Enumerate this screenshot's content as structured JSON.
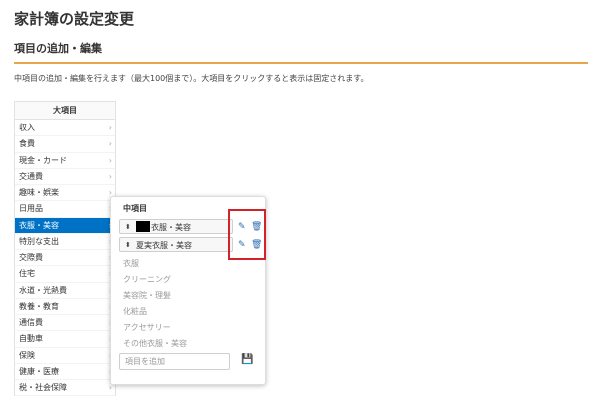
{
  "page": {
    "title": "家計簿の設定変更"
  },
  "section": {
    "title": "項目の追加・編集",
    "description": "中項目の追加・編集を行えます（最大100個まで）。大項目をクリックすると表示は固定されます。"
  },
  "categories": {
    "header": "大項目",
    "items": [
      {
        "label": "収入",
        "active": false
      },
      {
        "label": "食費",
        "active": false
      },
      {
        "label": "現金・カード",
        "active": false
      },
      {
        "label": "交通費",
        "active": false
      },
      {
        "label": "趣味・娯楽",
        "active": false
      },
      {
        "label": "日用品",
        "active": false
      },
      {
        "label": "衣服・美容",
        "active": true
      },
      {
        "label": "特別な支出",
        "active": false
      },
      {
        "label": "交際費",
        "active": false
      },
      {
        "label": "住宅",
        "active": false
      },
      {
        "label": "水道・光熱費",
        "active": false
      },
      {
        "label": "教養・教育",
        "active": false
      },
      {
        "label": "通信費",
        "active": false
      },
      {
        "label": "自動車",
        "active": false
      },
      {
        "label": "保険",
        "active": false
      },
      {
        "label": "健康・医療",
        "active": false
      },
      {
        "label": "税・社会保障",
        "active": false
      }
    ]
  },
  "subcategories": {
    "header": "中項目",
    "custom_items": [
      {
        "label": "衣服・美容",
        "redacted_prefix": true
      },
      {
        "label": "夏実衣服・美容",
        "redacted_prefix": false
      }
    ],
    "default_items": [
      "衣服",
      "クリーニング",
      "美容院・理髪",
      "化粧品",
      "アクセサリー",
      "その他衣服・美容"
    ],
    "add_input": {
      "placeholder": "項目を追加",
      "value": ""
    }
  },
  "icons": {
    "chevron": "chevron-right-icon",
    "drag": "drag-handle-icon",
    "edit": "pencil-icon",
    "delete": "trash-icon",
    "save": "save-icon"
  },
  "colors": {
    "accent_underline": "#e8a54a",
    "active_category": "#0072c6",
    "icon_blue": "#2e6db4",
    "highlight": "#d2232a"
  }
}
